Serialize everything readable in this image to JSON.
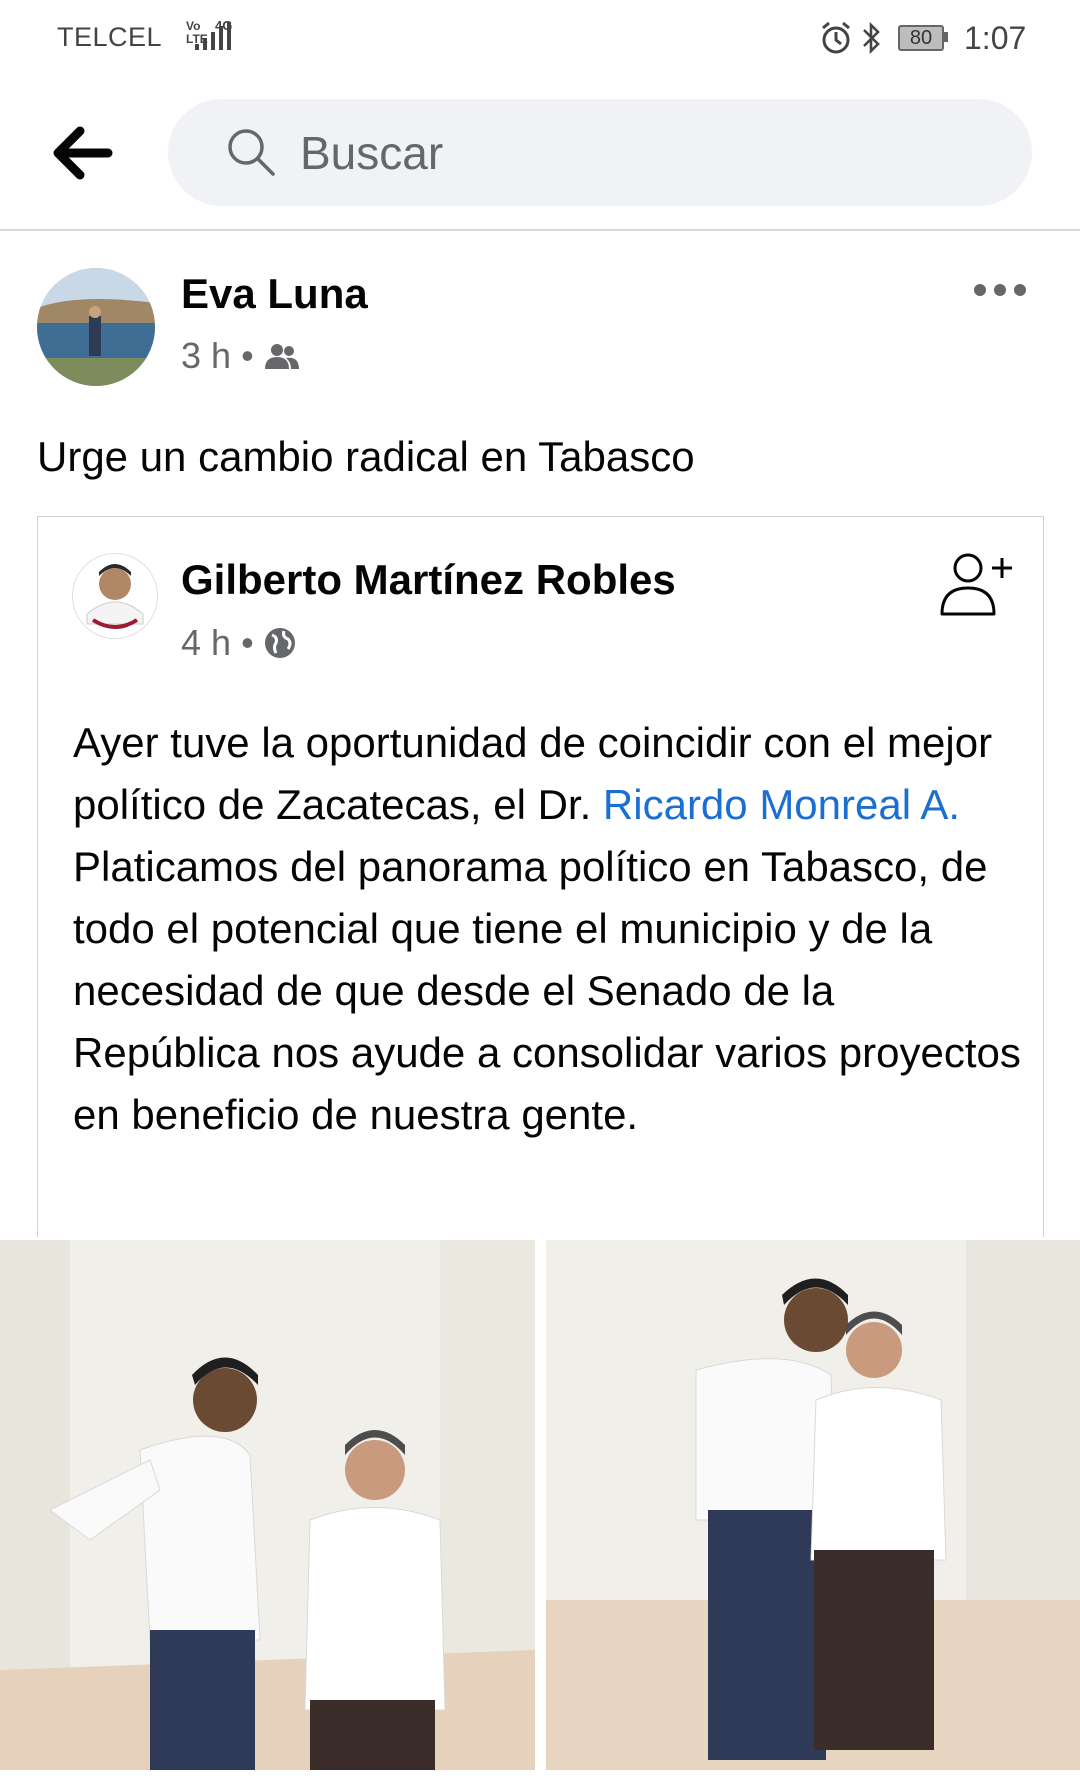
{
  "status_bar": {
    "carrier": "TELCEL",
    "volte": "Vo LTE",
    "network": "4G",
    "battery": "80",
    "time": "1:07"
  },
  "header": {
    "search_placeholder": "Buscar"
  },
  "post": {
    "author": "Eva Luna",
    "time": "3 h",
    "audience_icon": "friends-icon",
    "text": "Urge un cambio radical en Tabasco",
    "shared": {
      "author": "Gilberto Martínez Robles",
      "time": "4 h",
      "audience_icon": "globe-icon",
      "text_before_link": "Ayer tuve la oportunidad de coincidir con el mejor político de Zacatecas, el Dr. ",
      "link_text": "Ricardo Monreal A.",
      "text_after_link": " Platicamos del panorama político en Tabasco, de todo el potencial que tiene el municipio y de la necesidad de que desde el Senado de la República nos ayude a consolidar varios proyectos en beneficio de nuestra gente.",
      "photos": [
        "photo-1",
        "photo-2"
      ]
    }
  },
  "colors": {
    "link": "#1a6fd1",
    "meta": "#65676b",
    "search_bg": "#f0f2f5"
  }
}
